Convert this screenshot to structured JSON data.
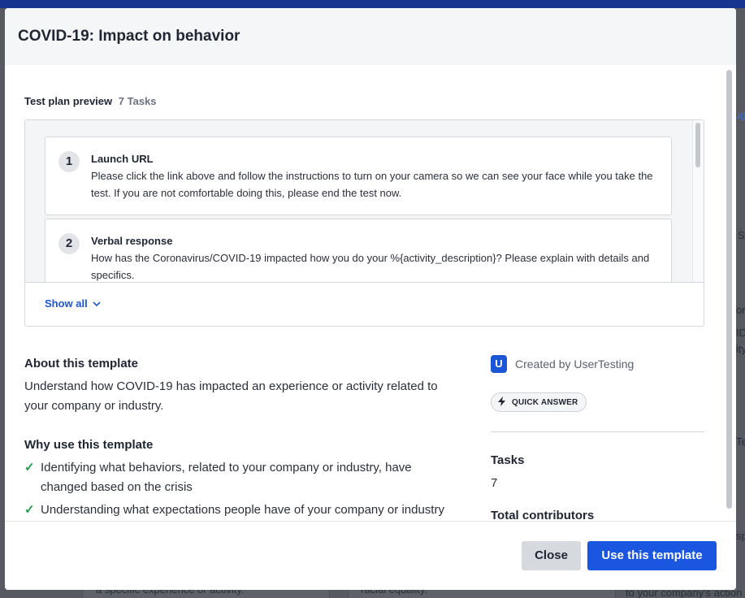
{
  "modal": {
    "title": "COVID-19: Impact on behavior",
    "preview_label": "Test plan preview",
    "preview_count": "7 Tasks",
    "tasks": [
      {
        "number": "1",
        "title": "Launch URL",
        "description": "Please click the link above and follow the instructions to turn on your camera so we can see your face while you take the test. If you are not comfortable doing this, please end the test now."
      },
      {
        "number": "2",
        "title": "Verbal response",
        "description": "How has the Coronavirus/COVID-19 impacted how you do your %{activity_description}? Please explain with details and specifics."
      }
    ],
    "show_all": "Show all",
    "about_title": "About this template",
    "about_text": "Understand how COVID-19 has impacted an experience or activity related to your company or industry.",
    "why_title": "Why use this template",
    "why_items": [
      "Identifying what behaviors, related to your company or industry, have changed based on the crisis",
      "Understanding what expectations people have of your company or industry during this situation"
    ],
    "creator": "Created by UserTesting",
    "creator_logo": "U",
    "badge": "QUICK ANSWER",
    "tasks_label": "Tasks",
    "tasks_value": "7",
    "contributors_label": "Total contributors",
    "close_label": "Close",
    "use_label": "Use this template"
  },
  "colors": {
    "primary": "#1a56e0",
    "check": "#1f9d4a",
    "topbar": "#15358f"
  },
  "background": {
    "fragments": [
      "ug",
      "a specific experience or activity.",
      "racial equality.",
      "to your company's action",
      "Tes",
      "S",
      "or",
      "ID",
      "ity",
      "sp"
    ]
  }
}
